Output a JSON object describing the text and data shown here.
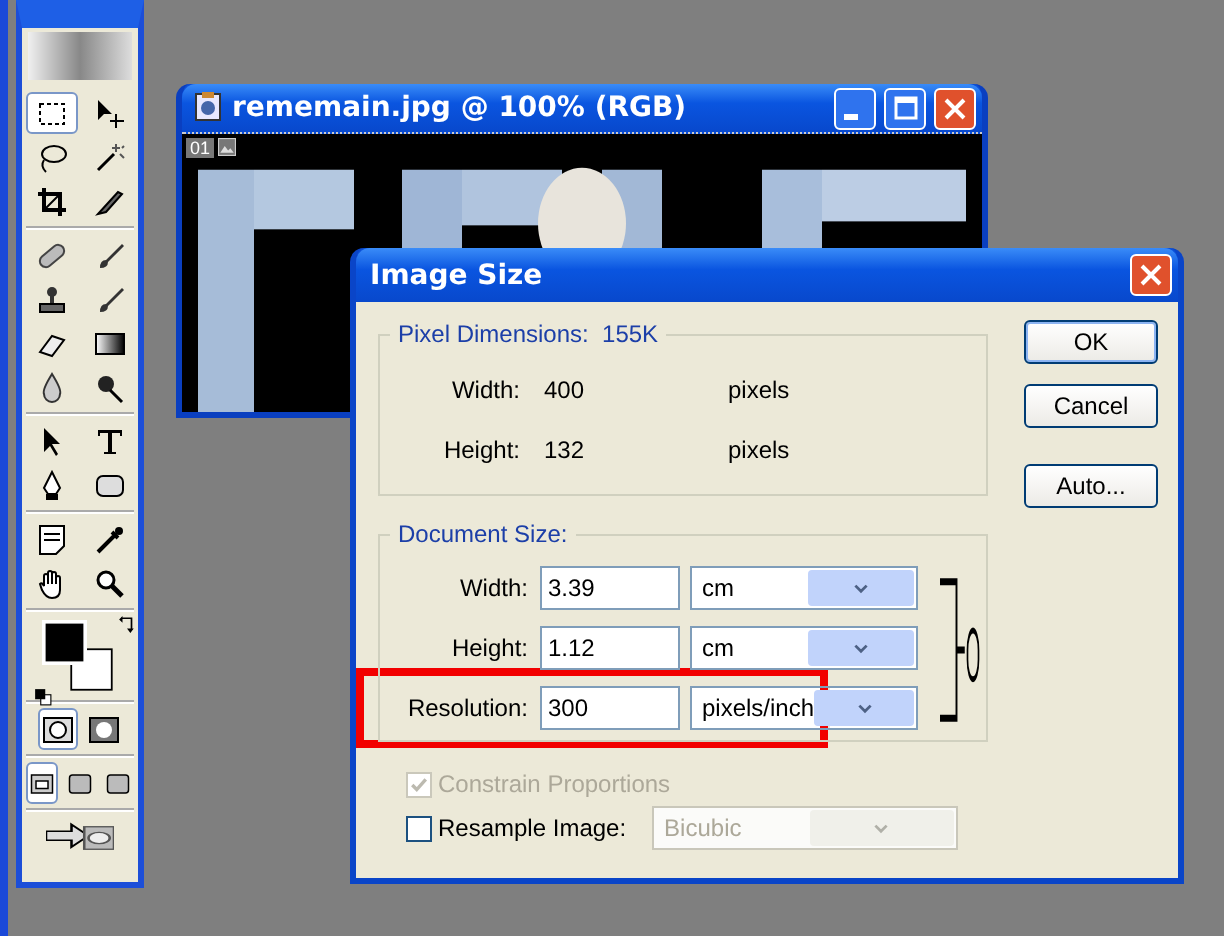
{
  "toolbox": {
    "tools": [
      {
        "kind": "marquee",
        "selected": true
      },
      {
        "kind": "move",
        "selected": false
      },
      {
        "kind": "lasso",
        "selected": false
      },
      {
        "kind": "wand",
        "selected": false
      },
      {
        "kind": "crop",
        "selected": false
      },
      {
        "kind": "slice",
        "selected": false
      },
      {
        "kind": "bandage",
        "selected": false
      },
      {
        "kind": "brush",
        "selected": false
      },
      {
        "kind": "stamp",
        "selected": false
      },
      {
        "kind": "brush",
        "selected": false
      },
      {
        "kind": "eraser",
        "selected": false
      },
      {
        "kind": "gradient",
        "selected": false
      },
      {
        "kind": "drop",
        "selected": false
      },
      {
        "kind": "dodge",
        "selected": false
      },
      {
        "kind": "arrow",
        "selected": false
      },
      {
        "kind": "type",
        "selected": false
      },
      {
        "kind": "pen",
        "selected": false
      },
      {
        "kind": "shape",
        "selected": false
      },
      {
        "kind": "note",
        "selected": false
      },
      {
        "kind": "eyedropper",
        "selected": false
      },
      {
        "kind": "hand",
        "selected": false
      },
      {
        "kind": "zoom",
        "selected": false
      }
    ],
    "mask_modes": [
      {
        "selected": true
      },
      {
        "selected": false
      }
    ],
    "screen_modes": [
      {
        "selected": true
      },
      {
        "selected": false
      },
      {
        "selected": false
      }
    ]
  },
  "document_window": {
    "title": "rememain.jpg @ 100% (RGB)",
    "badge": "01"
  },
  "dialog": {
    "title": "Image Size",
    "pixel_dimensions": {
      "legend": "Pixel Dimensions:",
      "size": "155K",
      "rows": [
        {
          "label": "Width:",
          "value": "400",
          "unit": "pixels"
        },
        {
          "label": "Height:",
          "value": "132",
          "unit": "pixels"
        }
      ]
    },
    "document_size": {
      "legend": "Document Size:",
      "rows": [
        {
          "label": "Width:",
          "value": "3.39",
          "unit": "cm",
          "highlighted": false
        },
        {
          "label": "Height:",
          "value": "1.12",
          "unit": "cm",
          "highlighted": false
        },
        {
          "label": "Resolution:",
          "value": "300",
          "unit": "pixels/inch",
          "highlighted": true
        }
      ]
    },
    "constrain_proportions": {
      "label": "Constrain Proportions",
      "checked": true,
      "disabled": true
    },
    "resample_image": {
      "label": "Resample Image:",
      "checked": false,
      "method": "Bicubic",
      "disabled": true
    },
    "buttons": [
      {
        "label": "OK",
        "default": true
      },
      {
        "label": "Cancel",
        "default": false
      },
      {
        "label": "Auto...",
        "default": false
      }
    ]
  }
}
